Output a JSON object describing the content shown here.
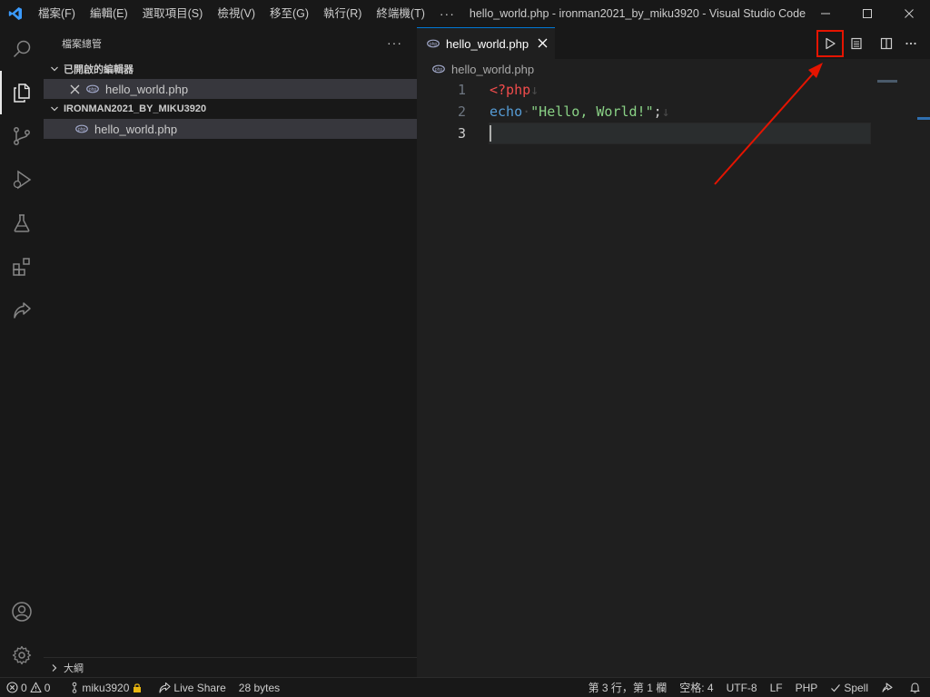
{
  "titlebar": {
    "menus": [
      "檔案(F)",
      "編輯(E)",
      "選取項目(S)",
      "檢視(V)",
      "移至(G)",
      "執行(R)",
      "終端機(T)"
    ],
    "more": "···",
    "window_title": "hello_world.php - ironman2021_by_miku3920 - Visual Studio Code [..."
  },
  "sidebar": {
    "header": "檔案總管",
    "more": "···",
    "open_editors_title": "已開啟的編輯器",
    "open_editors": [
      {
        "label": "hello_world.php"
      }
    ],
    "folder_title": "IRONMAN2021_BY_MIKU3920",
    "files": [
      {
        "label": "hello_world.php"
      }
    ],
    "outline_title": "大綱"
  },
  "editor": {
    "tab_label": "hello_world.php",
    "breadcrumb": "hello_world.php",
    "lines": [
      {
        "number": "1",
        "open_tag": "<?php",
        "eol": "↓"
      },
      {
        "number": "2",
        "keyword": "echo",
        "string": "\"Hello, World!\"",
        "semicolon": ";",
        "eol": "↓"
      },
      {
        "number": "3"
      }
    ]
  },
  "statusbar": {
    "errors": "0",
    "warnings": "0",
    "branch": "miku3920",
    "live_share": "Live Share",
    "file_size": "28 bytes",
    "position": "第 3 行，第 1 欄",
    "indent": "空格: 4",
    "encoding": "UTF-8",
    "eol": "LF",
    "language": "PHP",
    "spell": "Spell"
  },
  "colors": {
    "accent": "#0078d4",
    "annotation": "#e51400",
    "php_tag": "#f14c4c",
    "keyword": "#569cd6",
    "string": "#89d185"
  }
}
